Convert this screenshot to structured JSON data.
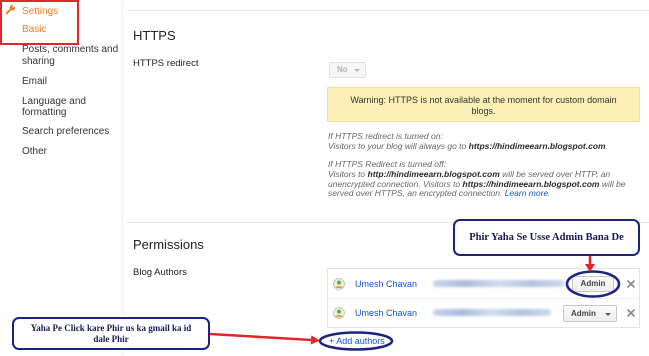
{
  "colors": {
    "accent_orange": "#f07d21",
    "text_dark": "#333333",
    "text_muted": "#666666",
    "link_blue": "#1155cc",
    "warning_bg": "#fcf0b6",
    "annotation_red": "#e3262b",
    "annotation_navy": "#1b237e"
  },
  "icons": {
    "settings": "wrench-icon",
    "dropdown": "chevron-down-icon",
    "remove_author": "close-icon",
    "author_avatar": "avatar"
  },
  "sidebar": {
    "title": "Settings",
    "items": [
      {
        "label": "Basic",
        "active": true
      },
      {
        "label": "Posts, comments and sharing",
        "active": false
      },
      {
        "label": "Email",
        "active": false
      },
      {
        "label": "Language and formatting",
        "active": false
      },
      {
        "label": "Search preferences",
        "active": false
      },
      {
        "label": "Other",
        "active": false
      }
    ]
  },
  "https": {
    "title": "HTTPS",
    "redirect_label": "HTTPS redirect",
    "redirect_value": "No",
    "redirect_disabled": true,
    "warning": "Warning: HTTPS is not available at the moment for custom domain blogs.",
    "help": {
      "on_heading": "If HTTPS redirect is turned on:",
      "on_line": [
        "Visitors to your blog will always go to ",
        "https://hindimeearn.blogspot.com",
        "."
      ],
      "off_heading": "If HTTPS Redirect is turned off:",
      "off_line_1": [
        "Visitors to ",
        "http://hindimeearn.blogspot.com",
        " will be served over HTTP, an"
      ],
      "off_line_2": [
        "unencrypted connection. Visitors to ",
        "https://hindimeearn.blogspot.com",
        " will be"
      ],
      "off_line_3": [
        "served over HTTPS, an encrypted connection. ",
        "Learn more."
      ]
    }
  },
  "permissions": {
    "title": "Permissions",
    "authors_label": "Blog Authors",
    "authors": [
      {
        "name": "Umesh Chavan",
        "role": "Admin"
      },
      {
        "name": "Umesh Chavan",
        "role": "Admin"
      }
    ],
    "add_authors_label": "+ Add authors"
  },
  "annotations": {
    "admin_note": "Phir Yaha Se Usse Admin Bana De",
    "add_note": "Yaha Pe Click kare Phir us ka gmail ka id dale Phir"
  }
}
